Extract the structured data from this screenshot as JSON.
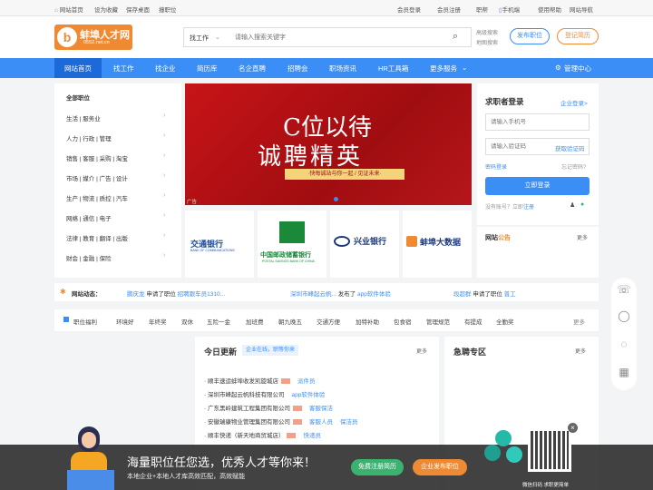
{
  "topbar": {
    "home": "网站首页",
    "fav": "设为收藏",
    "desktop": "保存桌面",
    "recruit": "撞职位",
    "member_login": "会员登录",
    "member_reg": "会员注册",
    "help_job": "职帮",
    "mobile": "手机端",
    "usage": "使用帮助",
    "sitenav": "网站导航"
  },
  "header": {
    "logo_text": "蚌埠人才网",
    "logo_domain": "0552.net.cn",
    "search_type": "找工作",
    "search_placeholder": "请输入搜索关键字",
    "adv_search": "高级搜索",
    "map_search": "地图搜索",
    "post_job": "发布职位",
    "register_resume": "登记简历"
  },
  "nav": [
    "网站首页",
    "找工作",
    "找企业",
    "简历库",
    "名企直聘",
    "招聘会",
    "职场资讯",
    "HR工具箱",
    "更多服务"
  ],
  "manage_center": "管理中心",
  "categories": {
    "title": "全部职位",
    "items": [
      "生活 | 服务业",
      "人力 | 行政 | 管理",
      "销售 | 客服 | 采购 | 淘宝",
      "市场 | 媒介 | 广告 | 设计",
      "生产 | 物流 | 质控 | 汽车",
      "网络 | 通信 | 电子",
      "法律 | 教育 | 翻译 | 出版",
      "财会 | 金融 | 保险"
    ]
  },
  "banner": {
    "line1": "C位以待",
    "line2": "诚聘精英",
    "sub": "·快每诚站与你一起 / 见证未来·",
    "ad": "广告"
  },
  "logos": [
    "交通银行",
    "中国邮政储蓄银行",
    "兴业银行",
    "蚌埠大数据"
  ],
  "logo_subs": [
    "BANK OF COMMUNICATIONS",
    "POSTAL SAVINGS BANK OF CHINA",
    "",
    ""
  ],
  "login": {
    "title": "求职者登录",
    "company": "企业登录>",
    "phone_ph": "请输入手机号",
    "code_ph": "请输入验证码",
    "get_code": "获取验证码",
    "pwd_login": "密码登录",
    "forgot": "忘记密码?",
    "submit": "立即登录",
    "no_account": "没有账号？立即",
    "register": "注册"
  },
  "notice": {
    "title": "网站",
    "title2": "公告",
    "more": "更多"
  },
  "dynamic": {
    "label": "网站动态：",
    "items": [
      {
        "name": "鹏庆龙",
        "act": "申请了职位",
        "job": "招聘跟车员1310..."
      },
      {
        "name": "深圳市峰起云帆...",
        "act": "发布了",
        "job": "app软件体验"
      },
      {
        "name": "段超群",
        "act": "申请了职位",
        "job": "普工"
      }
    ]
  },
  "welfare": {
    "label": "职位福利",
    "tags": [
      "环境好",
      "年终奖",
      "双休",
      "五险一金",
      "加班费",
      "朝九晚五",
      "交通方便",
      "加特补助",
      "包食宿",
      "管理规范",
      "有提成",
      "全勤奖"
    ],
    "more": "更多"
  },
  "today": {
    "title": "今日更新",
    "badge": "企业在线，职等你来",
    "more": "更多",
    "rows": [
      {
        "co": "顺丰速运蚌埠收发凯旋城店",
        "jobs": [
          "派件员"
        ]
      },
      {
        "co": "深圳市峰起云帆科技有限公司",
        "jobs": [
          "app软件体验"
        ]
      },
      {
        "co": "广东黑岭建筑工程集团有限公司",
        "jobs": [
          "客服保洁"
        ]
      },
      {
        "co": "安徽瑞康物业管理集团有限公司",
        "jobs": [
          "客服人员",
          "保洁员"
        ]
      },
      {
        "co": "顺丰快递（新天地商贸城店）",
        "jobs": [
          "快递员"
        ]
      }
    ]
  },
  "urgent": {
    "title": "急聘专区",
    "more": "更多"
  },
  "footer_banner": {
    "headline": "海量职位任您选，优秀人才等你来！",
    "sub": "本地企业+本地人才库高效匹配，高效赋能",
    "btn1": "免费注册简历",
    "btn2": "企业发布职位",
    "qr_label": "微信扫码 求职更简单"
  },
  "colors": {
    "brand": "#3a8ef5",
    "nav_active": "#1c6ad8",
    "orange": "#f08a32",
    "green": "#39b36f"
  }
}
